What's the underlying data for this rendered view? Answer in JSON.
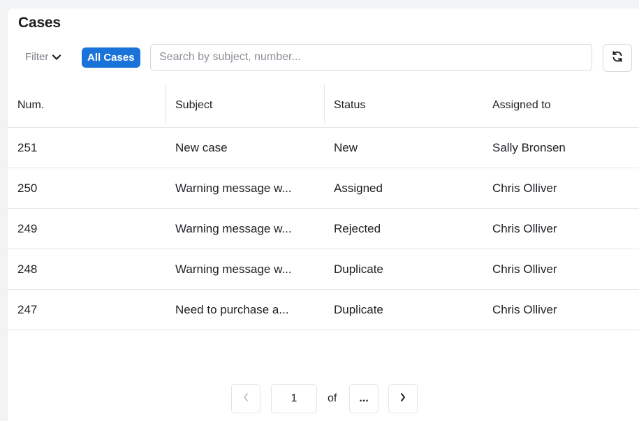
{
  "title": "Cases",
  "toolbar": {
    "filter_label": "Filter",
    "filter_icon": "chevron-down-icon",
    "active_filter": "All Cases",
    "search_placeholder": "Search by subject, number...",
    "search_value": "",
    "refresh_icon": "refresh-icon"
  },
  "table": {
    "columns": [
      "Num.",
      "Subject",
      "Status",
      "Assigned to"
    ],
    "rows": [
      {
        "num": "251",
        "subject": "New case",
        "status": "New",
        "assigned_to": "Sally Bronsen"
      },
      {
        "num": "250",
        "subject": "Warning message w...",
        "status": "Assigned",
        "assigned_to": "Chris Olliver"
      },
      {
        "num": "249",
        "subject": "Warning message w...",
        "status": "Rejected",
        "assigned_to": "Chris Olliver"
      },
      {
        "num": "248",
        "subject": "Warning message w...",
        "status": "Duplicate",
        "assigned_to": "Chris Olliver"
      },
      {
        "num": "247",
        "subject": "Need to purchase a...",
        "status": "Duplicate",
        "assigned_to": "Chris Olliver"
      }
    ]
  },
  "pagination": {
    "current_page": "1",
    "of_label": "of",
    "total_label": "...",
    "prev_icon": "chevron-left-icon",
    "next_icon": "chevron-right-icon"
  },
  "colors": {
    "accent": "#1a73d9",
    "border": "#e3e5e8",
    "muted_text": "#7a7f88"
  }
}
